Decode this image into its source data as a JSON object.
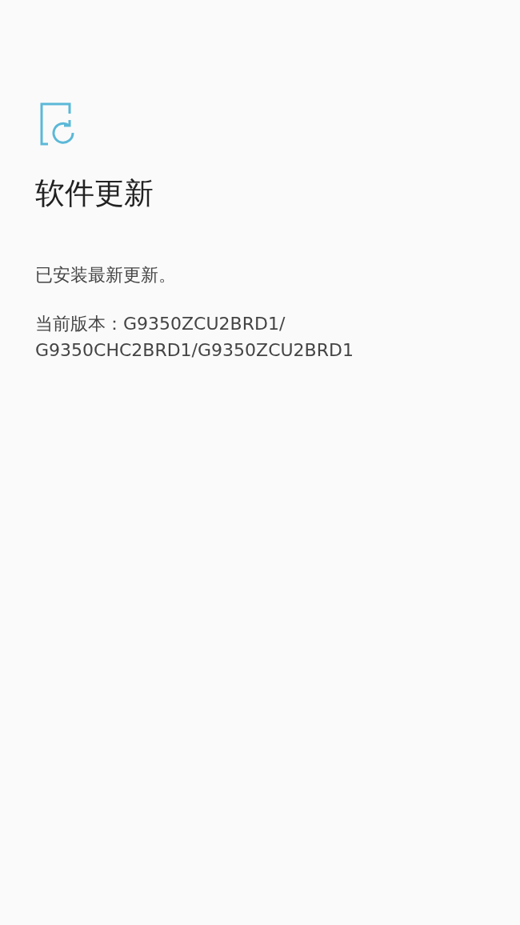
{
  "title": "软件更新",
  "status": "已安装最新更新。",
  "version_lines": [
    "当前版本：G9350ZCU2BRD1/",
    "G9350CHC2BRD1/G9350ZCU2BRD1"
  ]
}
